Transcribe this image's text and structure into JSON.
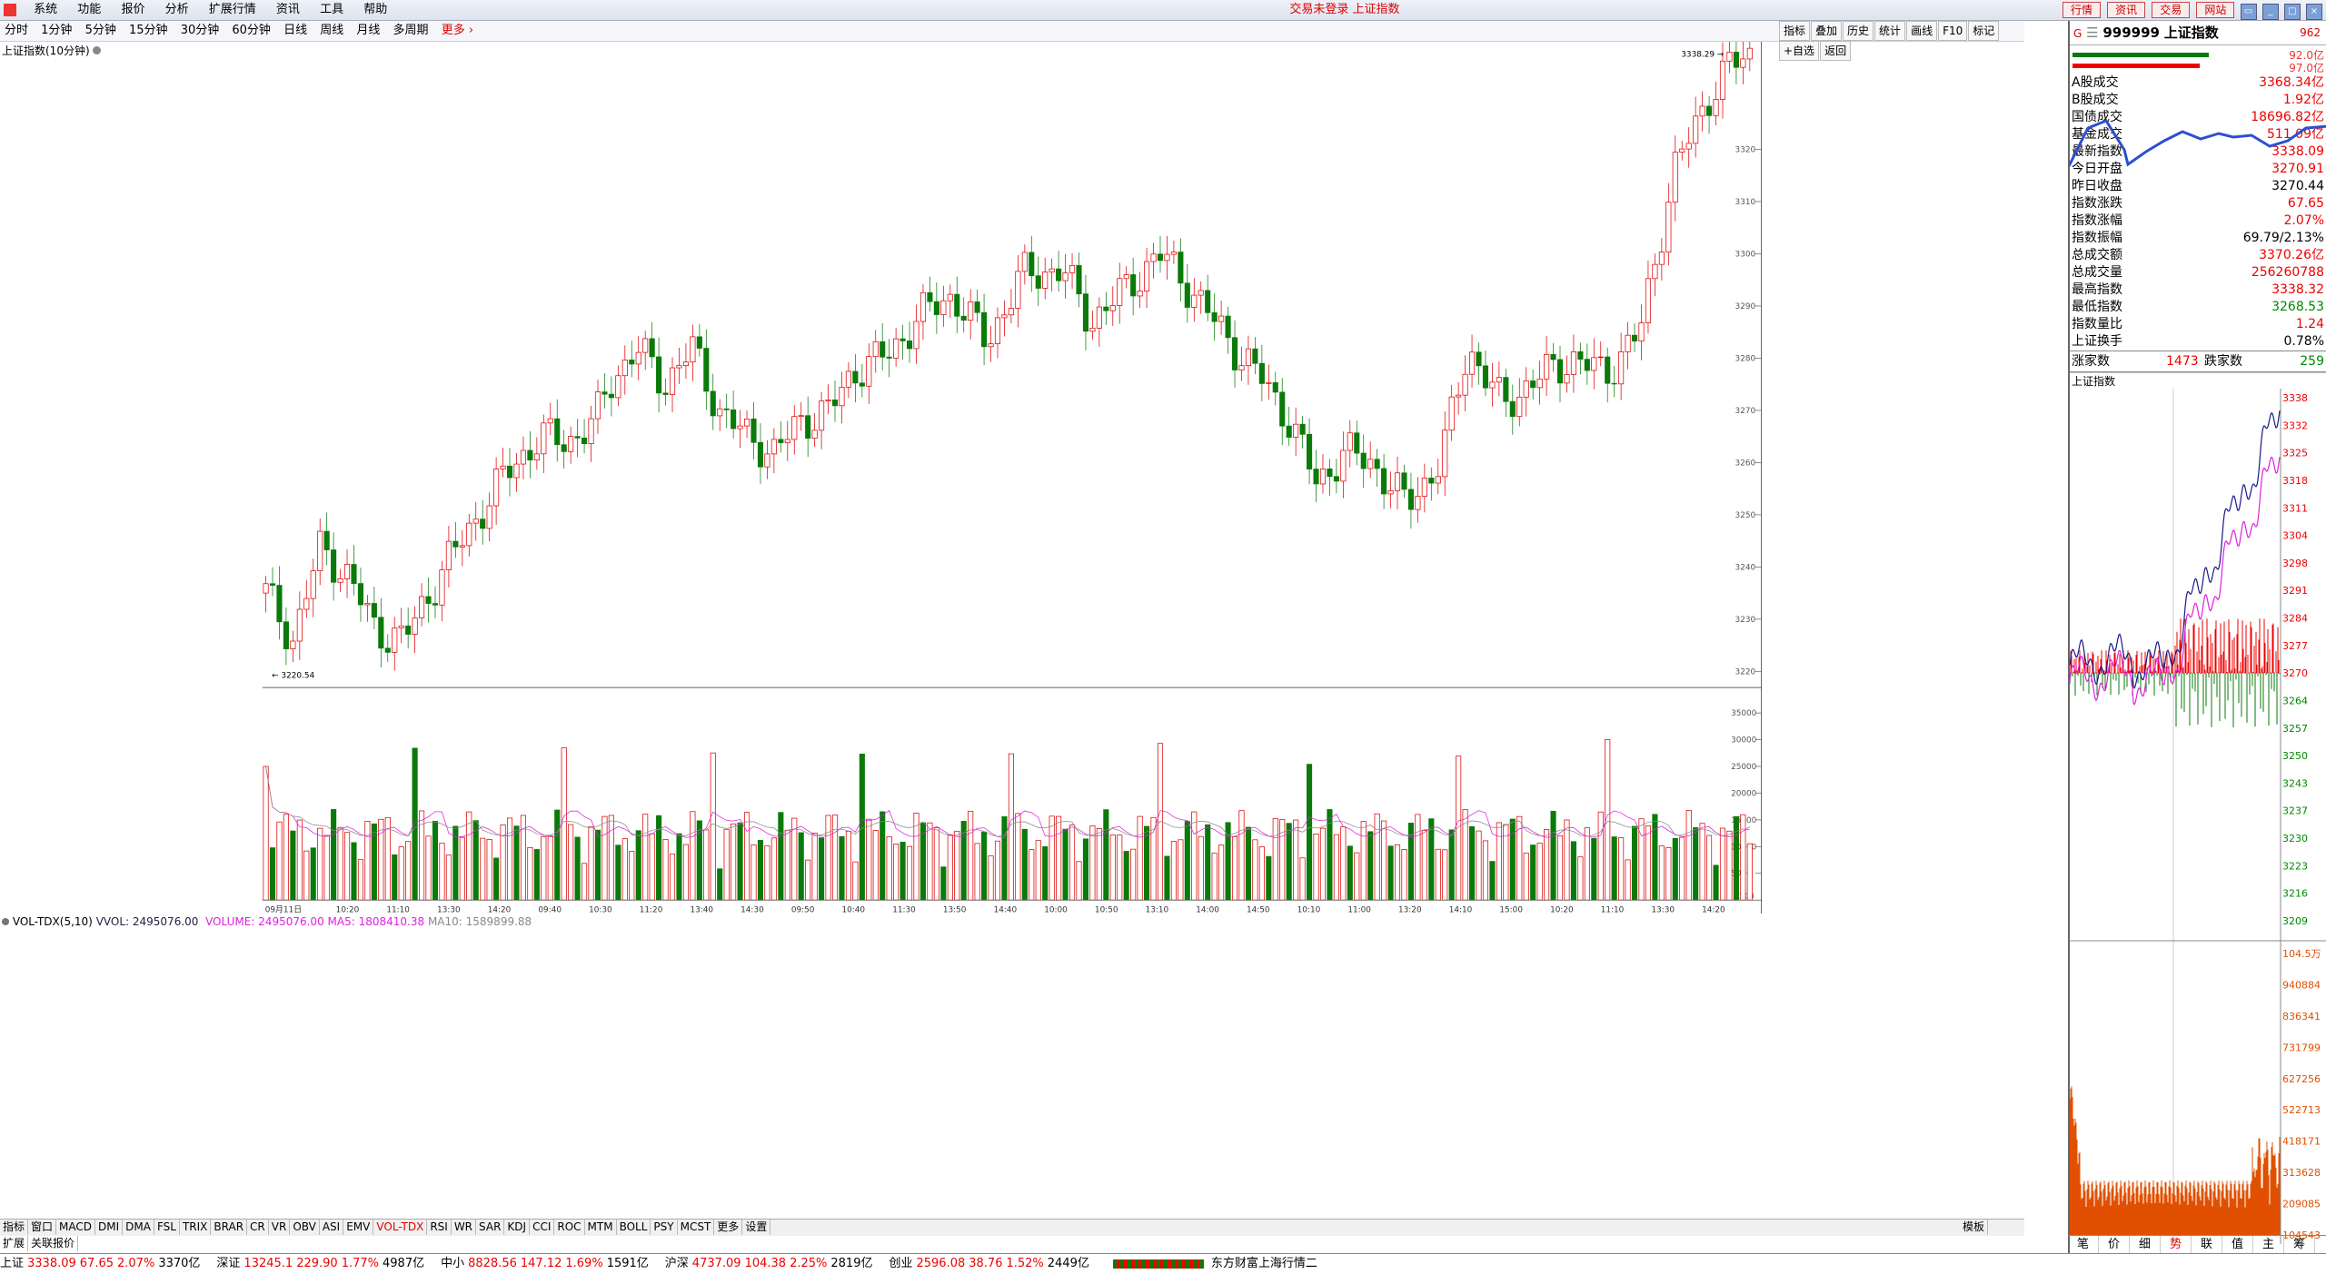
{
  "menubar": {
    "items": [
      "系统",
      "功能",
      "报价",
      "分析",
      "扩展行情",
      "资讯",
      "工具",
      "帮助"
    ],
    "window_title": "交易未登录 上证指数",
    "right_buttons": [
      "行情",
      "资讯",
      "交易",
      "网站"
    ]
  },
  "period_bar": {
    "items": [
      "分时",
      "1分钟",
      "5分钟",
      "15分钟",
      "30分钟",
      "60分钟",
      "日线",
      "周线",
      "月线",
      "多周期"
    ],
    "more": "更多"
  },
  "right_tools": [
    "指标",
    "叠加",
    "历史",
    "统计",
    "画线",
    "F10",
    "标记",
    "+自选",
    "返回"
  ],
  "chart": {
    "title": "上证指数(10分钟)",
    "high_label": "3338.29",
    "low_label": "3220.54",
    "price_ticks": [
      "3320",
      "3310",
      "3300",
      "3290",
      "3280",
      "3270",
      "3260",
      "3250",
      "3240",
      "3230",
      "3220"
    ],
    "time_labels": [
      "09月11日",
      "10:20",
      "11:10",
      "13:30",
      "14:20",
      "09:40",
      "10:30",
      "11:20",
      "13:40",
      "14:30",
      "09:50",
      "10:40",
      "11:30",
      "13:50",
      "14:40",
      "10:00",
      "10:50",
      "13:10",
      "14:00",
      "14:50",
      "10:10",
      "11:00",
      "13:20",
      "14:10",
      "15:00",
      "10:20",
      "11:10",
      "13:30",
      "14:20"
    ],
    "period_label": "10分钟",
    "indicator_title": "VOL-TDX(5,10)",
    "vvol_label": "VVOL: 2495076.00",
    "volume_label": "VOLUME: 2495076.00",
    "ma5_label": "MA5: 1808410.38",
    "ma10_label": "MA10: 1589899.88",
    "vol_ticks": [
      "35000",
      "30000",
      "25000",
      "20000",
      "15000",
      "10000",
      "5000"
    ],
    "vol_unit": "X100",
    "colors": {
      "up": "#e00000",
      "down": "#0a7a0a",
      "ma5": "#e020e0",
      "ma10": "#888888"
    }
  },
  "indicator_tabs": [
    "指标",
    "窗口",
    "MACD",
    "DMI",
    "DMA",
    "FSL",
    "TRIX",
    "BRAR",
    "CR",
    "VR",
    "OBV",
    "ASI",
    "EMV",
    "VOL-TDX",
    "RSI",
    "WR",
    "SAR",
    "KDJ",
    "CCI",
    "ROC",
    "MTM",
    "BOLL",
    "PSY",
    "MCST",
    "更多",
    "设置"
  ],
  "indicator_active": "VOL-TDX",
  "template_tab": "模板",
  "expand_tabs": [
    "扩展",
    "关联报价"
  ],
  "right_panel": {
    "code": "999999",
    "name": "上证指数",
    "tag": "962",
    "bar_vals": [
      "92.0亿",
      "97.0亿"
    ],
    "stats": [
      {
        "k": "A股成交",
        "v": "3368.34亿",
        "c": "up"
      },
      {
        "k": "B股成交",
        "v": "1.92亿",
        "c": "up"
      },
      {
        "k": "国债成交",
        "v": "18696.82亿",
        "c": "up"
      },
      {
        "k": "基金成交",
        "v": "511.09亿",
        "c": "up"
      },
      {
        "k": "最新指数",
        "v": "3338.09",
        "c": "up"
      },
      {
        "k": "今日开盘",
        "v": "3270.91",
        "c": "up"
      },
      {
        "k": "昨日收盘",
        "v": "3270.44",
        "c": "blk"
      },
      {
        "k": "指数涨跌",
        "v": "67.65",
        "c": "up"
      },
      {
        "k": "指数涨幅",
        "v": "2.07%",
        "c": "up"
      },
      {
        "k": "指数振幅",
        "v": "69.79/2.13%",
        "c": "blk"
      },
      {
        "k": "总成交额",
        "v": "3370.26亿",
        "c": "up"
      },
      {
        "k": "总成交量",
        "v": "256260788",
        "c": "up"
      },
      {
        "k": "最高指数",
        "v": "3338.32",
        "c": "up"
      },
      {
        "k": "最低指数",
        "v": "3268.53",
        "c": "dn"
      },
      {
        "k": "指数量比",
        "v": "1.24",
        "c": "up"
      },
      {
        "k": "上证换手",
        "v": "0.78%",
        "c": "blk"
      }
    ],
    "adv_label": "涨家数",
    "adv": "1473",
    "dec_label": "跌家数",
    "dec": "259",
    "mini_title": "上证指数",
    "mini_ticks": [
      "3338",
      "3332",
      "3325",
      "3318",
      "3311",
      "3304",
      "3298",
      "3291",
      "3284",
      "3277",
      "3270",
      "3264",
      "3257",
      "3250",
      "3243",
      "3237",
      "3230",
      "3223",
      "3216",
      "3209"
    ],
    "mini_vol_ticks": [
      "104.5万",
      "940884",
      "836341",
      "731799",
      "627256",
      "522713",
      "418171",
      "313628",
      "209085",
      "104543"
    ],
    "switch_tabs": [
      "笔",
      "价",
      "细",
      "势",
      "联",
      "值",
      "主",
      "筹"
    ],
    "switch_active": "势"
  },
  "statusbar": [
    {
      "name": "上证",
      "price": "3338.09",
      "chg": "67.65",
      "pct": "2.07%",
      "amt": "3370亿"
    },
    {
      "name": "深证",
      "price": "13245.1",
      "chg": "229.90",
      "pct": "1.77%",
      "amt": "4987亿"
    },
    {
      "name": "中小",
      "price": "8828.56",
      "chg": "147.12",
      "pct": "1.69%",
      "amt": "1591亿"
    },
    {
      "name": "沪深",
      "price": "4737.09",
      "chg": "104.38",
      "pct": "2.25%",
      "amt": "2819亿"
    },
    {
      "name": "创业",
      "price": "2596.08",
      "chg": "38.76",
      "pct": "1.52%",
      "amt": "2449亿"
    }
  ],
  "status_info": "东方财富上海行情二"
}
